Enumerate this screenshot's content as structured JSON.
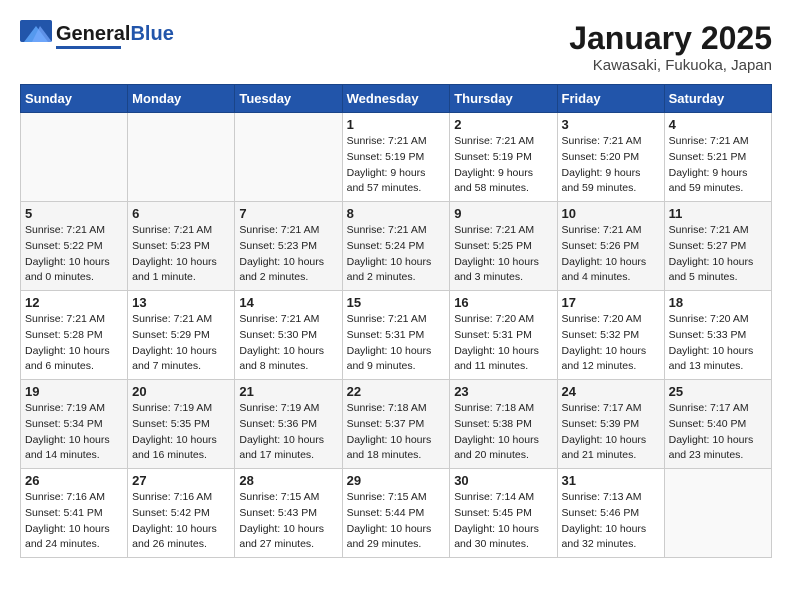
{
  "header": {
    "logo_general": "General",
    "logo_blue": "Blue",
    "month_title": "January 2025",
    "location": "Kawasaki, Fukuoka, Japan"
  },
  "days_of_week": [
    "Sunday",
    "Monday",
    "Tuesday",
    "Wednesday",
    "Thursday",
    "Friday",
    "Saturday"
  ],
  "weeks": [
    [
      {
        "day": "",
        "sunrise": "",
        "sunset": "",
        "daylight": ""
      },
      {
        "day": "",
        "sunrise": "",
        "sunset": "",
        "daylight": ""
      },
      {
        "day": "",
        "sunrise": "",
        "sunset": "",
        "daylight": ""
      },
      {
        "day": "1",
        "sunrise": "Sunrise: 7:21 AM",
        "sunset": "Sunset: 5:19 PM",
        "daylight": "Daylight: 9 hours and 57 minutes."
      },
      {
        "day": "2",
        "sunrise": "Sunrise: 7:21 AM",
        "sunset": "Sunset: 5:19 PM",
        "daylight": "Daylight: 9 hours and 58 minutes."
      },
      {
        "day": "3",
        "sunrise": "Sunrise: 7:21 AM",
        "sunset": "Sunset: 5:20 PM",
        "daylight": "Daylight: 9 hours and 59 minutes."
      },
      {
        "day": "4",
        "sunrise": "Sunrise: 7:21 AM",
        "sunset": "Sunset: 5:21 PM",
        "daylight": "Daylight: 9 hours and 59 minutes."
      }
    ],
    [
      {
        "day": "5",
        "sunrise": "Sunrise: 7:21 AM",
        "sunset": "Sunset: 5:22 PM",
        "daylight": "Daylight: 10 hours and 0 minutes."
      },
      {
        "day": "6",
        "sunrise": "Sunrise: 7:21 AM",
        "sunset": "Sunset: 5:23 PM",
        "daylight": "Daylight: 10 hours and 1 minute."
      },
      {
        "day": "7",
        "sunrise": "Sunrise: 7:21 AM",
        "sunset": "Sunset: 5:23 PM",
        "daylight": "Daylight: 10 hours and 2 minutes."
      },
      {
        "day": "8",
        "sunrise": "Sunrise: 7:21 AM",
        "sunset": "Sunset: 5:24 PM",
        "daylight": "Daylight: 10 hours and 2 minutes."
      },
      {
        "day": "9",
        "sunrise": "Sunrise: 7:21 AM",
        "sunset": "Sunset: 5:25 PM",
        "daylight": "Daylight: 10 hours and 3 minutes."
      },
      {
        "day": "10",
        "sunrise": "Sunrise: 7:21 AM",
        "sunset": "Sunset: 5:26 PM",
        "daylight": "Daylight: 10 hours and 4 minutes."
      },
      {
        "day": "11",
        "sunrise": "Sunrise: 7:21 AM",
        "sunset": "Sunset: 5:27 PM",
        "daylight": "Daylight: 10 hours and 5 minutes."
      }
    ],
    [
      {
        "day": "12",
        "sunrise": "Sunrise: 7:21 AM",
        "sunset": "Sunset: 5:28 PM",
        "daylight": "Daylight: 10 hours and 6 minutes."
      },
      {
        "day": "13",
        "sunrise": "Sunrise: 7:21 AM",
        "sunset": "Sunset: 5:29 PM",
        "daylight": "Daylight: 10 hours and 7 minutes."
      },
      {
        "day": "14",
        "sunrise": "Sunrise: 7:21 AM",
        "sunset": "Sunset: 5:30 PM",
        "daylight": "Daylight: 10 hours and 8 minutes."
      },
      {
        "day": "15",
        "sunrise": "Sunrise: 7:21 AM",
        "sunset": "Sunset: 5:31 PM",
        "daylight": "Daylight: 10 hours and 9 minutes."
      },
      {
        "day": "16",
        "sunrise": "Sunrise: 7:20 AM",
        "sunset": "Sunset: 5:31 PM",
        "daylight": "Daylight: 10 hours and 11 minutes."
      },
      {
        "day": "17",
        "sunrise": "Sunrise: 7:20 AM",
        "sunset": "Sunset: 5:32 PM",
        "daylight": "Daylight: 10 hours and 12 minutes."
      },
      {
        "day": "18",
        "sunrise": "Sunrise: 7:20 AM",
        "sunset": "Sunset: 5:33 PM",
        "daylight": "Daylight: 10 hours and 13 minutes."
      }
    ],
    [
      {
        "day": "19",
        "sunrise": "Sunrise: 7:19 AM",
        "sunset": "Sunset: 5:34 PM",
        "daylight": "Daylight: 10 hours and 14 minutes."
      },
      {
        "day": "20",
        "sunrise": "Sunrise: 7:19 AM",
        "sunset": "Sunset: 5:35 PM",
        "daylight": "Daylight: 10 hours and 16 minutes."
      },
      {
        "day": "21",
        "sunrise": "Sunrise: 7:19 AM",
        "sunset": "Sunset: 5:36 PM",
        "daylight": "Daylight: 10 hours and 17 minutes."
      },
      {
        "day": "22",
        "sunrise": "Sunrise: 7:18 AM",
        "sunset": "Sunset: 5:37 PM",
        "daylight": "Daylight: 10 hours and 18 minutes."
      },
      {
        "day": "23",
        "sunrise": "Sunrise: 7:18 AM",
        "sunset": "Sunset: 5:38 PM",
        "daylight": "Daylight: 10 hours and 20 minutes."
      },
      {
        "day": "24",
        "sunrise": "Sunrise: 7:17 AM",
        "sunset": "Sunset: 5:39 PM",
        "daylight": "Daylight: 10 hours and 21 minutes."
      },
      {
        "day": "25",
        "sunrise": "Sunrise: 7:17 AM",
        "sunset": "Sunset: 5:40 PM",
        "daylight": "Daylight: 10 hours and 23 minutes."
      }
    ],
    [
      {
        "day": "26",
        "sunrise": "Sunrise: 7:16 AM",
        "sunset": "Sunset: 5:41 PM",
        "daylight": "Daylight: 10 hours and 24 minutes."
      },
      {
        "day": "27",
        "sunrise": "Sunrise: 7:16 AM",
        "sunset": "Sunset: 5:42 PM",
        "daylight": "Daylight: 10 hours and 26 minutes."
      },
      {
        "day": "28",
        "sunrise": "Sunrise: 7:15 AM",
        "sunset": "Sunset: 5:43 PM",
        "daylight": "Daylight: 10 hours and 27 minutes."
      },
      {
        "day": "29",
        "sunrise": "Sunrise: 7:15 AM",
        "sunset": "Sunset: 5:44 PM",
        "daylight": "Daylight: 10 hours and 29 minutes."
      },
      {
        "day": "30",
        "sunrise": "Sunrise: 7:14 AM",
        "sunset": "Sunset: 5:45 PM",
        "daylight": "Daylight: 10 hours and 30 minutes."
      },
      {
        "day": "31",
        "sunrise": "Sunrise: 7:13 AM",
        "sunset": "Sunset: 5:46 PM",
        "daylight": "Daylight: 10 hours and 32 minutes."
      },
      {
        "day": "",
        "sunrise": "",
        "sunset": "",
        "daylight": ""
      }
    ]
  ]
}
